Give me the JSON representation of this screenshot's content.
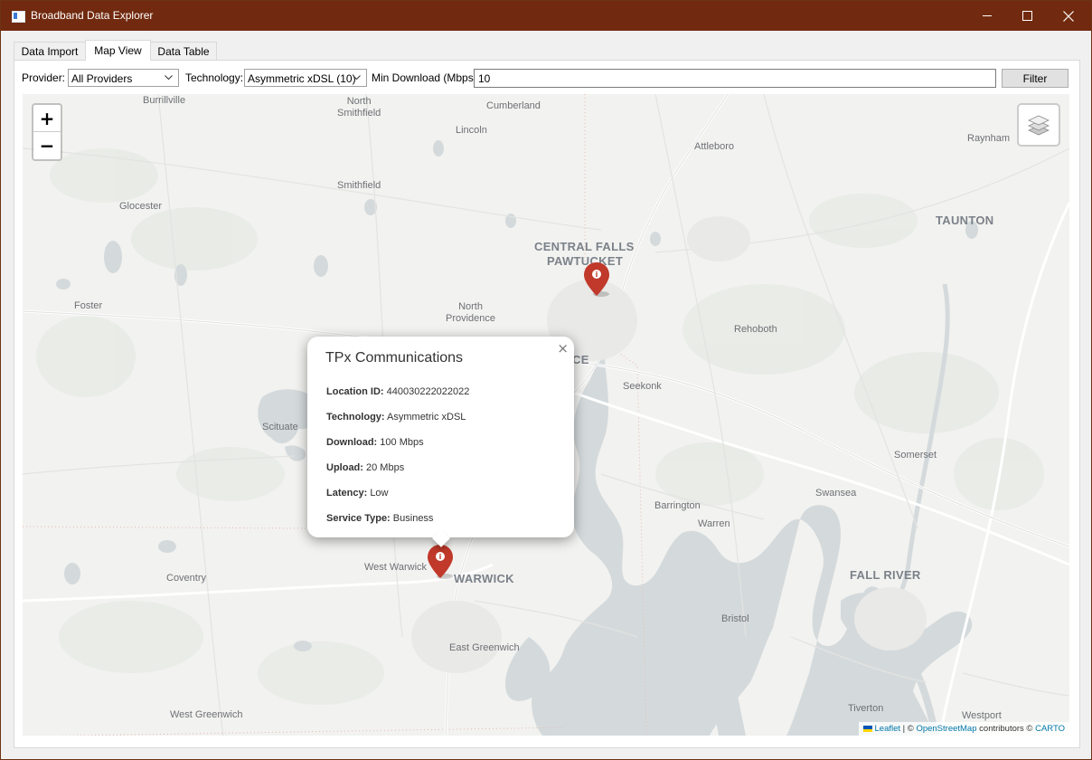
{
  "window": {
    "title": "Broadband Data Explorer",
    "controls": {
      "minimize": "minimize",
      "maximize": "maximize",
      "close": "close"
    }
  },
  "tabs": [
    {
      "label": "Data Import",
      "active": false
    },
    {
      "label": "Map View",
      "active": true
    },
    {
      "label": "Data Table",
      "active": false
    }
  ],
  "filters": {
    "provider_label": "Provider:",
    "provider_value": "All Providers",
    "technology_label": "Technology:",
    "technology_value": "Asymmetric xDSL (10)",
    "min_download_label": "Min Download (Mbps):",
    "min_download_value": "10",
    "filter_button": "Filter"
  },
  "map": {
    "zoom_in": "+",
    "zoom_out": "−",
    "places": {
      "burrillville": "Burrillville",
      "north_smithfield": "North\nSmithfield",
      "cumberland": "Cumberland",
      "lincoln": "Lincoln",
      "attleboro": "Attleboro",
      "raynham": "Raynham",
      "glocester": "Glocester",
      "smithfield": "Smithfield",
      "taunton": "TAUNTON",
      "central_falls": "CENTRAL FALLS",
      "pawtucket": "PAWTUCKET",
      "foster": "Foster",
      "north_providence": "North\nProvidence",
      "rehoboth": "Rehoboth",
      "providence_partial": "CE",
      "seekonk": "Seekonk",
      "scituate": "Scituate",
      "somerset": "Somerset",
      "barrington": "Barrington",
      "swansea": "Swansea",
      "warren": "Warren",
      "coventry": "Coventry",
      "west_warwick": "West Warwick",
      "warwick": "WARWICK",
      "fall_river": "FALL RIVER",
      "bristol": "Bristol",
      "east_greenwich": "East Greenwich",
      "west_greenwich": "West Greenwich",
      "tiverton": "Tiverton",
      "westport": "Westport"
    },
    "popup": {
      "title": "TPx Communications",
      "close": "×",
      "location_id_label": "Location ID:",
      "location_id_value": "440030222022022",
      "technology_label": "Technology:",
      "technology_value": "Asymmetric xDSL",
      "download_label": "Download:",
      "download_value": "100 Mbps",
      "upload_label": "Upload:",
      "upload_value": "20 Mbps",
      "latency_label": "Latency:",
      "latency_value": "Low",
      "service_type_label": "Service Type:",
      "service_type_value": "Business"
    },
    "attribution": {
      "leaflet": "Leaflet",
      "sep": " | © ",
      "osm": "OpenStreetMap",
      "contrib": " contributors © ",
      "carto": "CARTO"
    },
    "marker_color": "#c0392b",
    "water_color": "#d4dadc"
  }
}
